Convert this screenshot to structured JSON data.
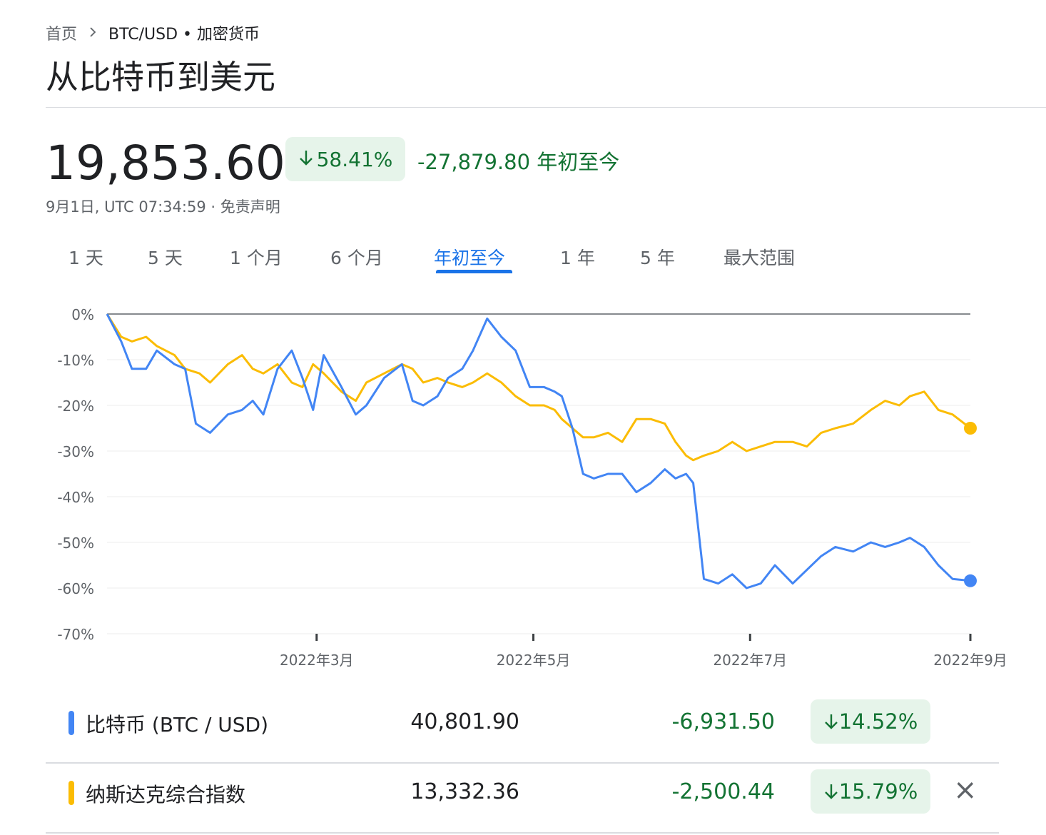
{
  "breadcrumb": {
    "home": "首页",
    "current": "BTC/USD • 加密货币"
  },
  "page_title": "从比特币到美元",
  "quote": {
    "price": "19,853.60",
    "change_pct": "58.41%",
    "change_abs": "-27,879.80 年初至今",
    "timestamp": "9月1日, UTC 07:34:59 · 免责声明"
  },
  "tabs": [
    "1 天",
    "5 天",
    "1 个月",
    "6 个月",
    "年初至今",
    "1 年",
    "5 年",
    "最大范围"
  ],
  "active_tab": "年初至今",
  "colors": {
    "btc": "#4285f4",
    "nasdaq": "#fbbc04",
    "positive": "#137333",
    "chip_bg": "#e6f4ea",
    "accent": "#1a73e8"
  },
  "chart_data": {
    "type": "line",
    "ylabel": "",
    "xlabel": "",
    "y_ticks": [
      "0%",
      "-10%",
      "-20%",
      "-30%",
      "-40%",
      "-50%",
      "-60%",
      "-70%"
    ],
    "ylim": [
      -70,
      0
    ],
    "x_ticks": [
      "2022年3月",
      "2022年5月",
      "2022年7月",
      "2022年9月"
    ],
    "x_range": [
      "2022-01-01",
      "2022-09-01"
    ],
    "x_tick_dates": [
      "2022-03-01",
      "2022-05-01",
      "2022-07-01",
      "2022-09-01"
    ],
    "series": [
      {
        "name": "比特币 (BTC / USD)",
        "x": [
          "2022-01-01",
          "2022-01-05",
          "2022-01-08",
          "2022-01-12",
          "2022-01-15",
          "2022-01-20",
          "2022-01-23",
          "2022-01-26",
          "2022-01-30",
          "2022-02-04",
          "2022-02-08",
          "2022-02-11",
          "2022-02-14",
          "2022-02-18",
          "2022-02-22",
          "2022-02-25",
          "2022-02-28",
          "2022-03-03",
          "2022-03-08",
          "2022-03-12",
          "2022-03-15",
          "2022-03-20",
          "2022-03-25",
          "2022-03-28",
          "2022-03-31",
          "2022-04-04",
          "2022-04-07",
          "2022-04-11",
          "2022-04-14",
          "2022-04-18",
          "2022-04-22",
          "2022-04-26",
          "2022-04-30",
          "2022-05-04",
          "2022-05-07",
          "2022-05-09",
          "2022-05-12",
          "2022-05-15",
          "2022-05-18",
          "2022-05-22",
          "2022-05-26",
          "2022-05-30",
          "2022-06-03",
          "2022-06-07",
          "2022-06-10",
          "2022-06-13",
          "2022-06-15",
          "2022-06-18",
          "2022-06-22",
          "2022-06-26",
          "2022-06-30",
          "2022-07-04",
          "2022-07-08",
          "2022-07-13",
          "2022-07-17",
          "2022-07-21",
          "2022-07-25",
          "2022-07-30",
          "2022-08-04",
          "2022-08-08",
          "2022-08-12",
          "2022-08-15",
          "2022-08-19",
          "2022-08-23",
          "2022-08-27",
          "2022-09-01"
        ],
        "values": [
          0,
          -6,
          -12,
          -12,
          -8,
          -11,
          -12,
          -24,
          -26,
          -22,
          -21,
          -19,
          -22,
          -12,
          -8,
          -14,
          -21,
          -9,
          -16,
          -22,
          -20,
          -14,
          -11,
          -19,
          -20,
          -18,
          -14,
          -12,
          -8,
          -1,
          -5,
          -8,
          -16,
          -16,
          -17,
          -18,
          -25,
          -35,
          -36,
          -35,
          -35,
          -39,
          -37,
          -34,
          -36,
          -35,
          -37,
          -58,
          -59,
          -57,
          -60,
          -59,
          -55,
          -59,
          -56,
          -53,
          -51,
          -52,
          -50,
          -51,
          -50,
          -49,
          -51,
          -55,
          -58,
          -58.4
        ]
      },
      {
        "name": "纳斯达克综合指数",
        "x": [
          "2022-01-01",
          "2022-01-05",
          "2022-01-08",
          "2022-01-12",
          "2022-01-15",
          "2022-01-20",
          "2022-01-23",
          "2022-01-27",
          "2022-01-30",
          "2022-02-04",
          "2022-02-08",
          "2022-02-11",
          "2022-02-14",
          "2022-02-18",
          "2022-02-22",
          "2022-02-25",
          "2022-02-28",
          "2022-03-03",
          "2022-03-08",
          "2022-03-12",
          "2022-03-15",
          "2022-03-20",
          "2022-03-25",
          "2022-03-28",
          "2022-03-31",
          "2022-04-04",
          "2022-04-07",
          "2022-04-11",
          "2022-04-14",
          "2022-04-18",
          "2022-04-22",
          "2022-04-26",
          "2022-04-30",
          "2022-05-04",
          "2022-05-07",
          "2022-05-09",
          "2022-05-12",
          "2022-05-15",
          "2022-05-18",
          "2022-05-22",
          "2022-05-26",
          "2022-05-30",
          "2022-06-03",
          "2022-06-07",
          "2022-06-10",
          "2022-06-13",
          "2022-06-15",
          "2022-06-18",
          "2022-06-22",
          "2022-06-26",
          "2022-06-30",
          "2022-07-04",
          "2022-07-08",
          "2022-07-13",
          "2022-07-17",
          "2022-07-21",
          "2022-07-25",
          "2022-07-30",
          "2022-08-04",
          "2022-08-08",
          "2022-08-12",
          "2022-08-15",
          "2022-08-19",
          "2022-08-23",
          "2022-08-27",
          "2022-09-01"
        ],
        "values": [
          0,
          -5,
          -6,
          -5,
          -7,
          -9,
          -12,
          -13,
          -15,
          -11,
          -9,
          -12,
          -13,
          -11,
          -15,
          -16,
          -11,
          -13,
          -17,
          -19,
          -15,
          -13,
          -11,
          -12,
          -15,
          -14,
          -15,
          -16,
          -15,
          -13,
          -15,
          -18,
          -20,
          -20,
          -21,
          -23,
          -25,
          -27,
          -27,
          -26,
          -28,
          -23,
          -23,
          -24,
          -28,
          -31,
          -32,
          -31,
          -30,
          -28,
          -30,
          -29,
          -28,
          -28,
          -29,
          -26,
          -25,
          -24,
          -21,
          -19,
          -20,
          -18,
          -17,
          -21,
          -22,
          -25
        ]
      }
    ]
  },
  "legend_rows": [
    {
      "name": "比特币 (BTC / USD)",
      "value": "40,801.90",
      "change": "-6,931.50",
      "pct": "14.52%"
    },
    {
      "name": "纳斯达克综合指数",
      "value": "13,332.36",
      "change": "-2,500.44",
      "pct": "15.79%",
      "close_icon": "×"
    }
  ]
}
